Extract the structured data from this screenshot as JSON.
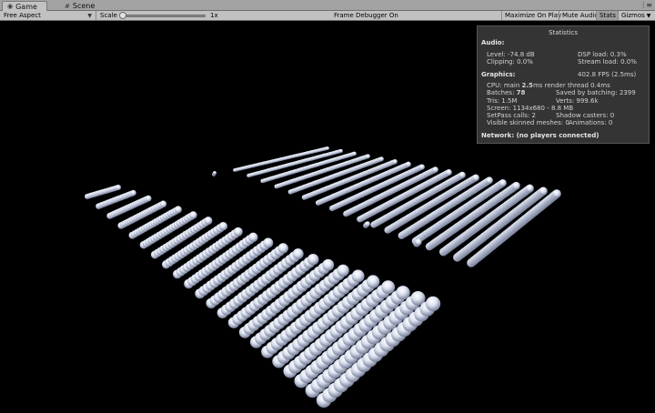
{
  "tabs": [
    {
      "label": "Game",
      "icon": "game-icon"
    },
    {
      "label": "Scene",
      "icon": "scene-grid-icon"
    }
  ],
  "toolbar": {
    "aspect": "Free Aspect",
    "scale_label": "Scale",
    "scale_value": "1x",
    "scale_level": 0.0,
    "frame_debugger": "Frame Debugger On",
    "maximize": "Maximize On Play",
    "mute": "Mute Audio",
    "stats": "Stats",
    "gizmos": "Gizmos"
  },
  "stats": {
    "title": "Statistics",
    "audio_header": "Audio:",
    "level": "Level: -74.8 dB",
    "clipping": "Clipping: 0.0%",
    "dsp_load": "DSP load: 0.3%",
    "stream_load": "Stream load: 0.0%",
    "graphics_header": "Graphics:",
    "fps": "402.8 FPS (2.5ms)",
    "cpu_prefix": "CPU: main ",
    "cpu_main": "2.5",
    "cpu_suffix": "ms  render thread 0.4ms",
    "batches_prefix": "Batches: ",
    "batches": "78",
    "saved_batching": "Saved by batching: 2399",
    "tris": "Tris: 1.5M",
    "verts": "Verts: 999.6k",
    "screen": "Screen: 1134x680 - 8.8 MB",
    "setpass": "SetPass calls: 2",
    "shadow_casters": "Shadow casters: 0",
    "skinned": "Visible skinned meshes: 0",
    "animations": "Animations: 0",
    "network": "Network: (no players connected)"
  },
  "colors": {
    "sphere_highlight": "#ffffff",
    "sphere_mid": "#dbe1ef",
    "sphere_shadow": "#6f7792",
    "viewport_bg": "#000000"
  }
}
